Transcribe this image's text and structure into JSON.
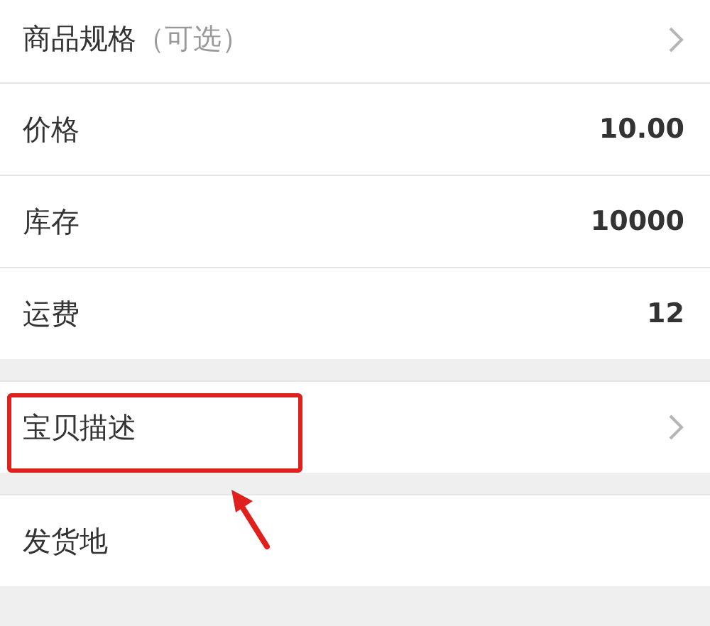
{
  "sections": [
    {
      "rows": [
        {
          "kind": "link",
          "label": "商品规格",
          "hint": "（可选）"
        },
        {
          "kind": "value",
          "label": "价格",
          "value": "10.00"
        },
        {
          "kind": "value",
          "label": "库存",
          "value": "10000"
        },
        {
          "kind": "value",
          "label": "运费",
          "value": "12"
        }
      ]
    },
    {
      "rows": [
        {
          "kind": "link",
          "label": "宝贝描述",
          "highlighted": true
        }
      ]
    },
    {
      "rows": [
        {
          "kind": "plain",
          "label": "发货地"
        }
      ]
    }
  ]
}
